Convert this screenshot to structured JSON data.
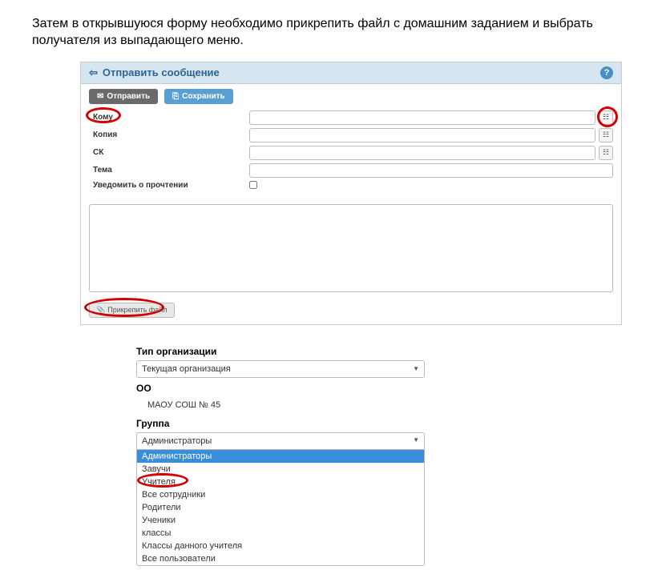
{
  "instruction_text": "Затем в открывшуюся форму необходимо прикрепить файл с домашним заданием и выбрать получателя из выпадающего меню.",
  "panel1": {
    "header_title": "Отправить сообщение",
    "back_icon": "arrow-left",
    "help": "?",
    "toolbar": {
      "send_label": "Отправить",
      "send_icon": "✉",
      "save_label": "Сохранить",
      "save_icon": "⎘"
    },
    "fields": {
      "to_label": "Кому",
      "copy_label": "Копия",
      "bcc_label": "СК",
      "subject_label": "Тема",
      "read_receipt_label": "Уведомить о прочтении"
    },
    "attach_label": "Прикрепить файл",
    "attach_icon": "📎"
  },
  "panel2": {
    "org_type_label": "Тип организации",
    "org_type_value": "Текущая организация",
    "oo_label": "ОО",
    "oo_value": "МАОУ СОШ № 45",
    "group_label": "Группа",
    "group_selected": "Администраторы",
    "group_options": [
      "Администраторы",
      "Завучи",
      "Учителя",
      "Все сотрудники",
      "Родители",
      "Ученики",
      "классы",
      "Классы данного учителя",
      "Все пользователи"
    ]
  },
  "colors": {
    "highlight": "#d40000",
    "header_bg": "#d6e6f0",
    "link": "#2a6496"
  }
}
